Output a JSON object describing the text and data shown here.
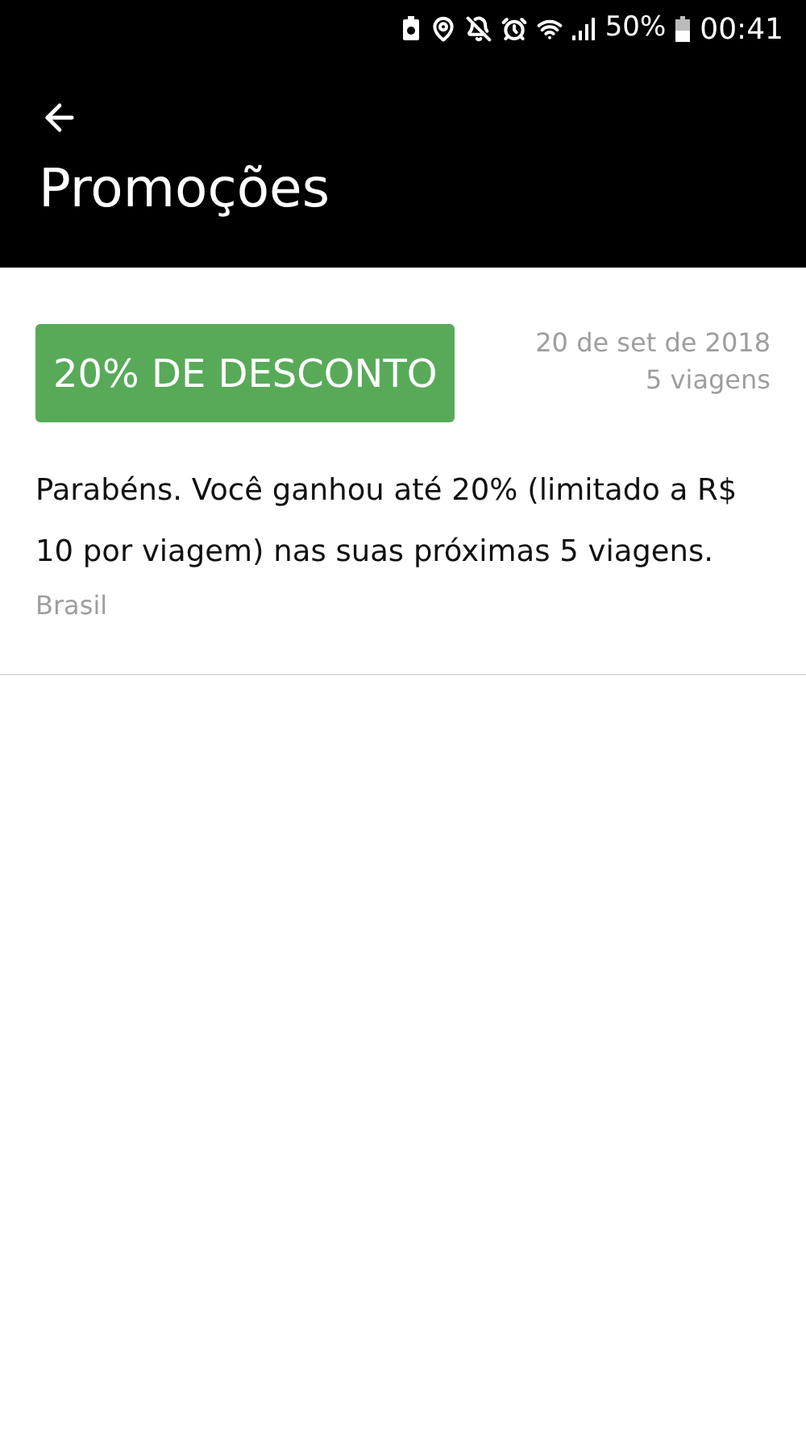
{
  "status_bar": {
    "battery": "50%",
    "time": "00:41"
  },
  "header": {
    "title": "Promoções"
  },
  "promotions": [
    {
      "badge": "20% DE DESCONTO",
      "date": "20 de set de 2018",
      "trips": "5 viagens",
      "description": "Parabéns. Você ganhou até 20% (limitado a R$ 10 por viagem) nas suas próximas 5 viagens.",
      "region": "Brasil"
    }
  ]
}
